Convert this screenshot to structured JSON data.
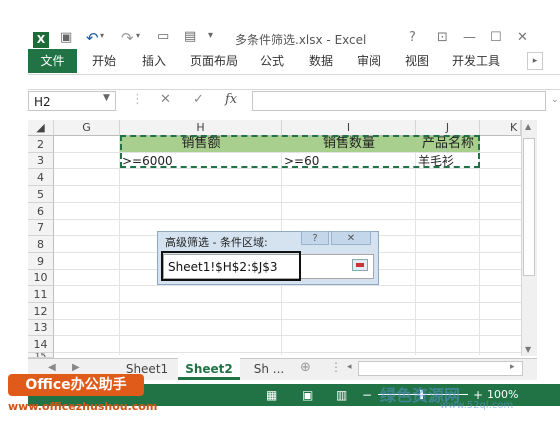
{
  "window": {
    "title": "多条件筛选.xlsx - Excel",
    "help": "?",
    "restore": "⊡",
    "minimize": "—",
    "maximize": "☐",
    "close": "✕"
  },
  "quick_access": {
    "save": "💾",
    "undo": "↶",
    "redo": "↷"
  },
  "ribbon": {
    "file": "文件",
    "tabs": [
      "开始",
      "插入",
      "页面布局",
      "公式",
      "数据",
      "审阅",
      "视图",
      "开发工具"
    ]
  },
  "formula_bar": {
    "name_box": "H2",
    "cancel": "✕",
    "enter": "✓",
    "fx": "fx",
    "value": ""
  },
  "grid": {
    "columns": [
      "G",
      "H",
      "I",
      "J",
      "K"
    ],
    "rows": [
      "2",
      "3",
      "4",
      "5",
      "6",
      "7",
      "8",
      "9",
      "10",
      "11",
      "12",
      "13",
      "14",
      "15"
    ],
    "headers": [
      "销售额",
      "销售数量",
      "产品名称"
    ],
    "criteria": [
      ">=6000",
      ">=60",
      "羊毛衫"
    ],
    "header_fill": "#a8cf8d"
  },
  "sheets": [
    "Sheet1",
    "Sheet2",
    "Sh ..."
  ],
  "active_sheet": "Sheet2",
  "status": {
    "zoom": "100%"
  },
  "dialog": {
    "title": "高级筛选 - 条件区域:",
    "help": "?",
    "close": "✕",
    "value": "Sheet1!$H$2:$J$3"
  },
  "watermark": {
    "badge": "Office办公助手",
    "url": "www.officezhushou.com",
    "right_top": "绿色资源网",
    "right_bottom": "www.52ql.com"
  },
  "colors": {
    "excel_green": "#217346",
    "accent_orange": "#e05a1a"
  }
}
